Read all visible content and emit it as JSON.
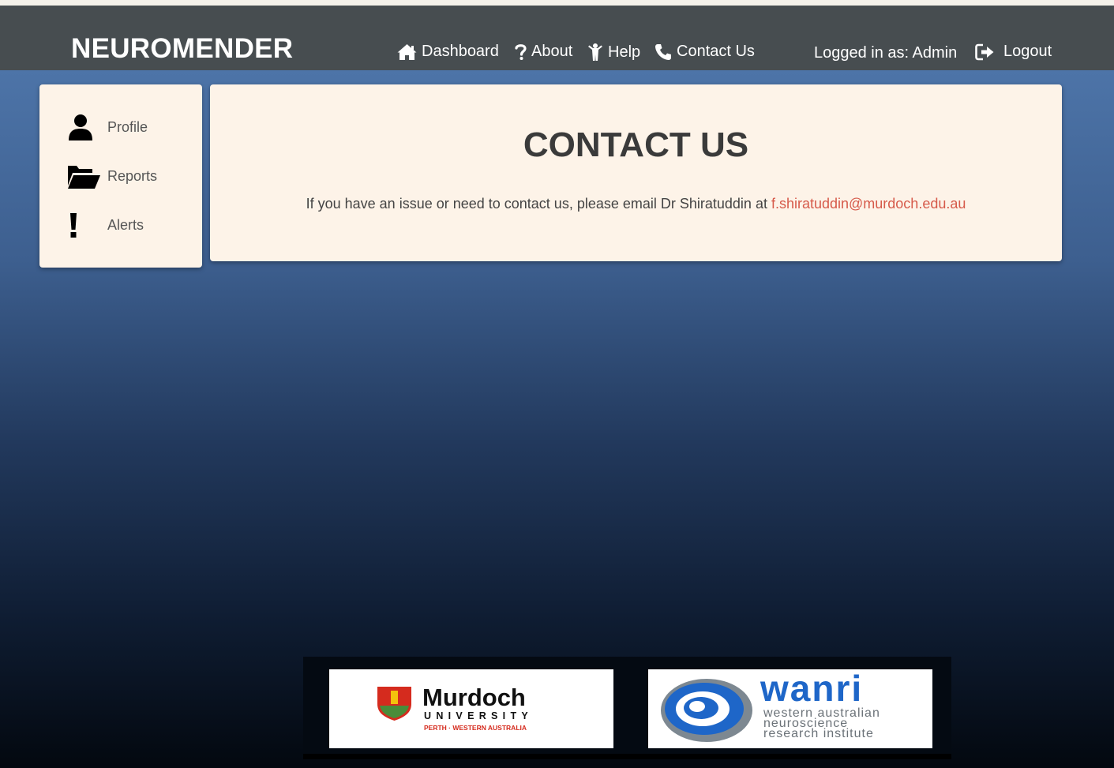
{
  "app": {
    "brand": "NEUROMENDER"
  },
  "nav": {
    "links": [
      {
        "label": "Dashboard",
        "icon": "home-icon"
      },
      {
        "label": "About",
        "icon": "question-icon"
      },
      {
        "label": "Help",
        "icon": "person-help-icon"
      },
      {
        "label": "Contact Us",
        "icon": "phone-icon"
      }
    ],
    "logged_in_text": "Logged in as: Admin",
    "logout_label": "Logout",
    "logout_icon": "logout-icon"
  },
  "sidebar": {
    "items": [
      {
        "label": "Profile",
        "icon": "user-icon"
      },
      {
        "label": "Reports",
        "icon": "folder-open-icon"
      },
      {
        "label": "Alerts",
        "icon": "exclamation-icon"
      }
    ]
  },
  "main": {
    "title": "CONTACT US",
    "message": "If you have an issue or need to contact us, please email Dr Shiratuddin at ",
    "email": "f.shiratuddin@murdoch.edu.au"
  },
  "footer": {
    "murdoch": {
      "name": "Murdoch",
      "sub": "UNIVERSITY",
      "tagline": "PERTH · WESTERN AUSTRALIA"
    },
    "wanri": {
      "name": "wanri",
      "line1": "western australian",
      "line2": "neuroscience",
      "line3": "research institute"
    }
  },
  "colors": {
    "navbar": "#474d50",
    "panel": "#fdf3e8",
    "link": "#d65a4a",
    "murdoch_red": "#d52b1e",
    "wanri_blue": "#1e66c8"
  }
}
